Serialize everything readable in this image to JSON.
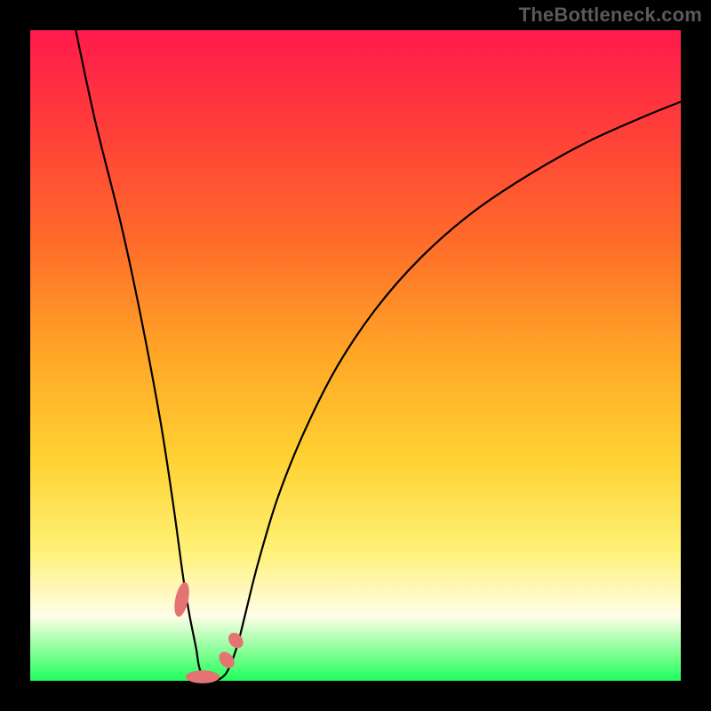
{
  "watermark": "TheBottleneck.com",
  "chart_data": {
    "type": "line",
    "title": "",
    "xlabel": "",
    "ylabel": "",
    "xlim": [
      0,
      100
    ],
    "ylim": [
      0,
      100
    ],
    "series": [
      {
        "name": "curve",
        "x": [
          7,
          10,
          14,
          17,
          20,
          22,
          23.5,
          24.5,
          25.5,
          26,
          27,
          28.5,
          30,
          31,
          32,
          33,
          35,
          38,
          42,
          47,
          53,
          60,
          68,
          77,
          86,
          95,
          100
        ],
        "values": [
          100,
          86,
          70,
          56,
          40,
          27,
          16,
          10,
          5,
          2,
          0,
          0,
          1,
          3,
          6,
          10,
          18,
          28,
          38,
          48,
          57,
          65,
          72,
          78,
          83,
          87,
          89
        ]
      }
    ],
    "markers": [
      {
        "cx": 23.3,
        "cy": 12.5,
        "rx": 1.0,
        "ry": 2.7,
        "angle_deg": 12
      },
      {
        "cx": 26.5,
        "cy": 0.6,
        "rx": 2.6,
        "ry": 1.0,
        "angle_deg": 0
      },
      {
        "cx": 30.2,
        "cy": 3.2,
        "rx": 1.0,
        "ry": 1.4,
        "angle_deg": -40
      },
      {
        "cx": 31.6,
        "cy": 6.2,
        "rx": 1.0,
        "ry": 1.3,
        "angle_deg": -40
      }
    ],
    "gradient_stops": [
      {
        "pos": 0,
        "color": "#ff1a4d"
      },
      {
        "pos": 14,
        "color": "#ff3b3b"
      },
      {
        "pos": 32,
        "color": "#ff6a2a"
      },
      {
        "pos": 50,
        "color": "#ffa726"
      },
      {
        "pos": 66,
        "color": "#ffd233"
      },
      {
        "pos": 80,
        "color": "#fff176"
      },
      {
        "pos": 90,
        "color": "#fffde7"
      },
      {
        "pos": 96,
        "color": "#7bff8f"
      },
      {
        "pos": 100,
        "color": "#1eff5e"
      }
    ]
  }
}
